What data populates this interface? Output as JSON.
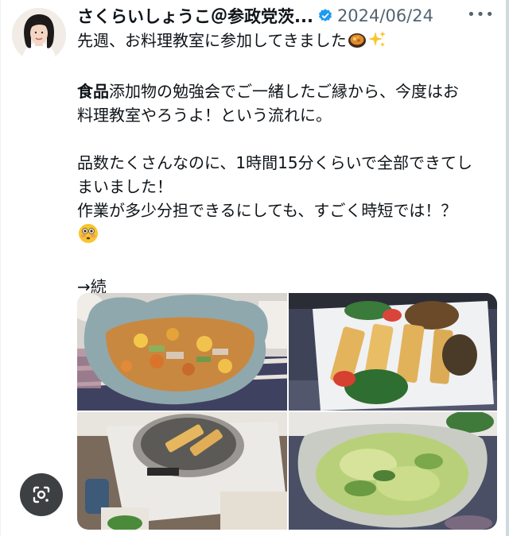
{
  "tweet": {
    "display_name": "さくらいしょうこ＠参政党茨...",
    "date": "2024/06/24",
    "more_label": "•••",
    "line1": "先週、お料理教室に参加してきました",
    "line2_bold": "食品",
    "line2_rest": "添加物の勉強会でご一緒したご縁から、今度はお",
    "line3": "料理教室やろうよ！という流れに。",
    "line4": "品数たくさんなのに、1時間15分くらいで全部できてし",
    "line5": "まいました！",
    "line6": "作業が多少分担できるにしても、すごく時短では！？",
    "continue_label": "→続"
  },
  "icons": {
    "verified": "verified-badge-icon",
    "lens": "google-lens-icon",
    "emoji_curry": "curry-emoji-icon",
    "emoji_sparkles": "sparkles-emoji-icon",
    "emoji_flushed": "flushed-face-emoji-icon"
  },
  "colors": {
    "verified_blue": "#1d9bf0",
    "secondary_text": "#536471",
    "primary_text": "#0f1419",
    "lens_button_bg": "#3c4043"
  }
}
